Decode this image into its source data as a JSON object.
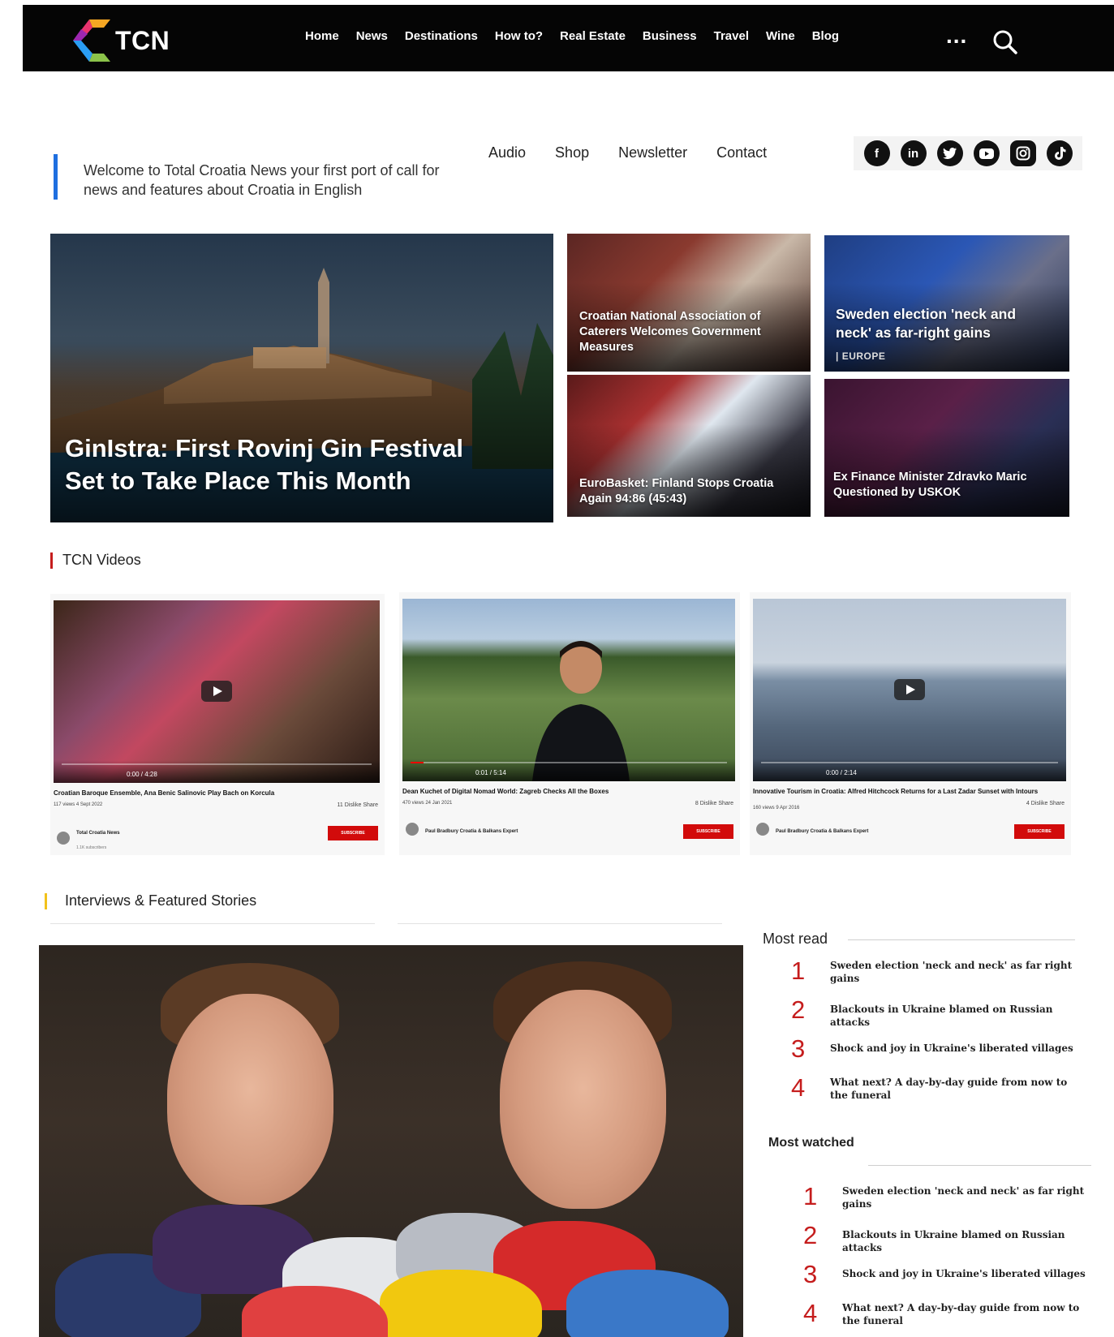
{
  "brand": {
    "name": "TCN"
  },
  "nav": {
    "items": [
      "Home",
      "News",
      "Destinations",
      "How to?",
      "Real Estate",
      "Business",
      "Travel",
      "Wine",
      "Blog"
    ],
    "more": "..."
  },
  "welcome": {
    "text": "Welcome to Total Croatia News your first port of call for news and features about Croatia in English"
  },
  "subnav": {
    "items": [
      "Audio",
      "Shop",
      "Newsletter",
      "Contact"
    ]
  },
  "social": {
    "icons": [
      "facebook-icon",
      "linkedin-icon",
      "twitter-icon",
      "youtube-icon",
      "instagram-icon",
      "tiktok-icon"
    ]
  },
  "hero": {
    "main": {
      "title": "GinIstra: First Rovinj Gin Festival Set to Take Place This Month"
    },
    "tile1": {
      "title": "Croatian National Association of Caterers Welcomes Government Measures"
    },
    "tile2": {
      "title": "Sweden election 'neck and neck' as far-right gains",
      "tag": "| EUROPE"
    },
    "tile3": {
      "title": "EuroBasket: Finland Stops Croatia Again 94:86 (45:43)"
    },
    "tile4": {
      "title": "Ex Finance Minister Zdravko Maric Questioned by USKOK"
    }
  },
  "sections": {
    "videos": "TCN Videos",
    "interviews": "Interviews & Featured Stories"
  },
  "videos": [
    {
      "title": "Croatian Baroque Ensemble, Ana Benic Salinovic Play Bach on Korcula",
      "meta": "117 views  4 Sept 2022",
      "time": "0:00 / 4:28",
      "progress": 0.0,
      "channel": "Total Croatia News",
      "subs": "1.1K subscribers",
      "subscribe": "SUBSCRIBE",
      "actions": "11   Dislike   Share"
    },
    {
      "title": "Dean Kuchet of Digital Nomad World: Zagreb Checks All the Boxes",
      "meta": "470 views  24 Jan 2021",
      "time": "0:01 / 5:14",
      "progress": 0.04,
      "channel": "Paul Bradbury Croatia & Balkans Expert",
      "subs": "",
      "subscribe": "SUBSCRIBE",
      "actions": "8   Dislike   Share"
    },
    {
      "title": "Innovative Tourism in Croatia: Alfred Hitchcock Returns for a Last Zadar Sunset with Intours",
      "meta": "160 views  9 Apr 2016",
      "time": "0:00 / 2:14",
      "progress": 0.0,
      "channel": "Paul Bradbury Croatia & Balkans Expert",
      "subs": "",
      "subscribe": "SUBSCRIBE",
      "actions": "4   Dislike   Share"
    }
  ],
  "sidebar": {
    "most_read": {
      "title": "Most read",
      "items": [
        {
          "num": "1",
          "text": "Sweden election 'neck and neck' as far right gains"
        },
        {
          "num": "2",
          "text": "Blackouts in Ukraine blamed on Russian attacks"
        },
        {
          "num": "3",
          "text": "Shock and joy in Ukraine's liberated villages"
        },
        {
          "num": "4",
          "text": "What next? A day-by-day guide from now to the funeral"
        }
      ]
    },
    "most_watched": {
      "title": "Most watched",
      "items": [
        {
          "num": "1",
          "text": "Sweden election 'neck and neck' as far right gains"
        },
        {
          "num": "2",
          "text": "Blackouts in Ukraine blamed on Russian attacks"
        },
        {
          "num": "3",
          "text": "Shock and joy in Ukraine's liberated villages"
        },
        {
          "num": "4",
          "text": "What next? A day-by-day guide from now to the funeral"
        }
      ]
    }
  },
  "colors": {
    "accent_blue": "#1e6fe0",
    "accent_red": "#c51d1d",
    "accent_yellow": "#f2c21b",
    "nav_bg": "#050505"
  }
}
